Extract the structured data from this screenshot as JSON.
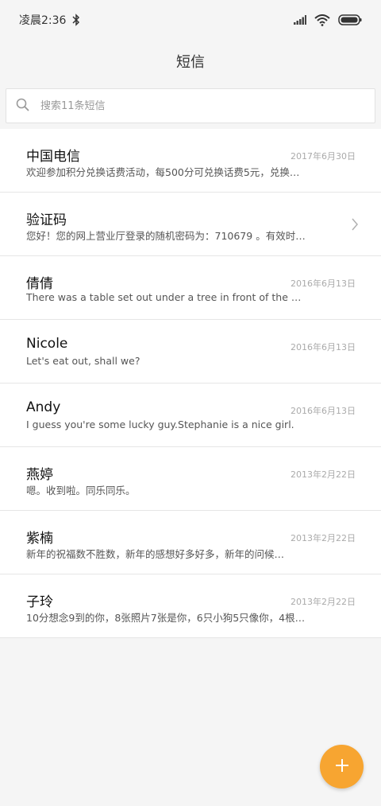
{
  "status_bar": {
    "time": "凌晨2:36",
    "icons": [
      "bluetooth-icon",
      "signal-icon",
      "wifi-icon",
      "battery-icon"
    ]
  },
  "header": {
    "title": "短信"
  },
  "search": {
    "placeholder": "搜索11条短信"
  },
  "messages": [
    {
      "sender": "中国电信",
      "date": "2017年6月30日",
      "preview": "欢迎参加积分兑换话费活动，每500分可兑换话费5元，兑换…"
    },
    {
      "sender": "验证码",
      "date": "",
      "preview": "您好！您的网上营业厅登录的随机密码为：710679 。有效时…",
      "has_chevron": true
    },
    {
      "sender": "倩倩",
      "date": "2016年6月13日",
      "preview": "There was a table set out under a tree in front of the …"
    },
    {
      "sender": "Nicole",
      "date": "2016年6月13日",
      "preview": "Let's eat out, shall we?"
    },
    {
      "sender": "Andy",
      "date": "2016年6月13日",
      "preview": "I guess you're some lucky guy.Stephanie is a nice girl."
    },
    {
      "sender": "燕婷",
      "date": "2013年2月22日",
      "preview": "嗯。收到啦。同乐同乐。"
    },
    {
      "sender": "紫楠",
      "date": "2013年2月22日",
      "preview": "新年的祝福数不胜数，新年的感想好多好多，新年的问候…"
    },
    {
      "sender": "子玲",
      "date": "2013年2月22日",
      "preview": "10分想念9到的你，8张照片7张是你，6只小狗5只像你，4根…"
    }
  ],
  "colors": {
    "accent": "#f7a531",
    "background": "#f5f5f5"
  },
  "fab": {
    "icon": "plus-icon"
  }
}
